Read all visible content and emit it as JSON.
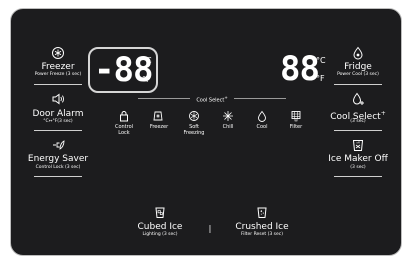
{
  "left": {
    "freezer": {
      "label": "Freezer",
      "sub": "Power Freeze (3 sec)"
    },
    "door_alarm": {
      "label": "Door Alarm",
      "sub": "°C↔°F(3 sec)"
    },
    "energy_saver": {
      "label": "Energy Saver",
      "sub": "Control Lock (3 sec)"
    }
  },
  "freezer_display": {
    "value": "-88",
    "unit_c": "°C",
    "unit_f": "°F"
  },
  "fridge_display": {
    "value": "88",
    "unit_c": "°C",
    "unit_f": "°F"
  },
  "right": {
    "fridge": {
      "label": "Fridge",
      "sub": "Power Cool (3 sec)"
    },
    "cool_select": {
      "label": "Cool Select",
      "plus": "+",
      "sub": "(3 sec)"
    },
    "ice_maker": {
      "label": "Ice Maker Off",
      "sub": "(3 sec)"
    }
  },
  "cool_select_title": "Cool Select",
  "cool_select_title_plus": "+",
  "center_icons": [
    {
      "label": "Control",
      "label2": "Lock"
    },
    {
      "label": "Freezer"
    },
    {
      "label": "Soft",
      "label2": "Freezing"
    },
    {
      "label": "Chill"
    },
    {
      "label": "Cool"
    },
    {
      "label": "Filter"
    }
  ],
  "bottom": {
    "cubed": {
      "label": "Cubed Ice",
      "sub": "Lighting (3 sec)"
    },
    "crushed": {
      "label": "Crushed Ice",
      "sub": "Filter Reset (3 sec)"
    },
    "divider": "|"
  }
}
